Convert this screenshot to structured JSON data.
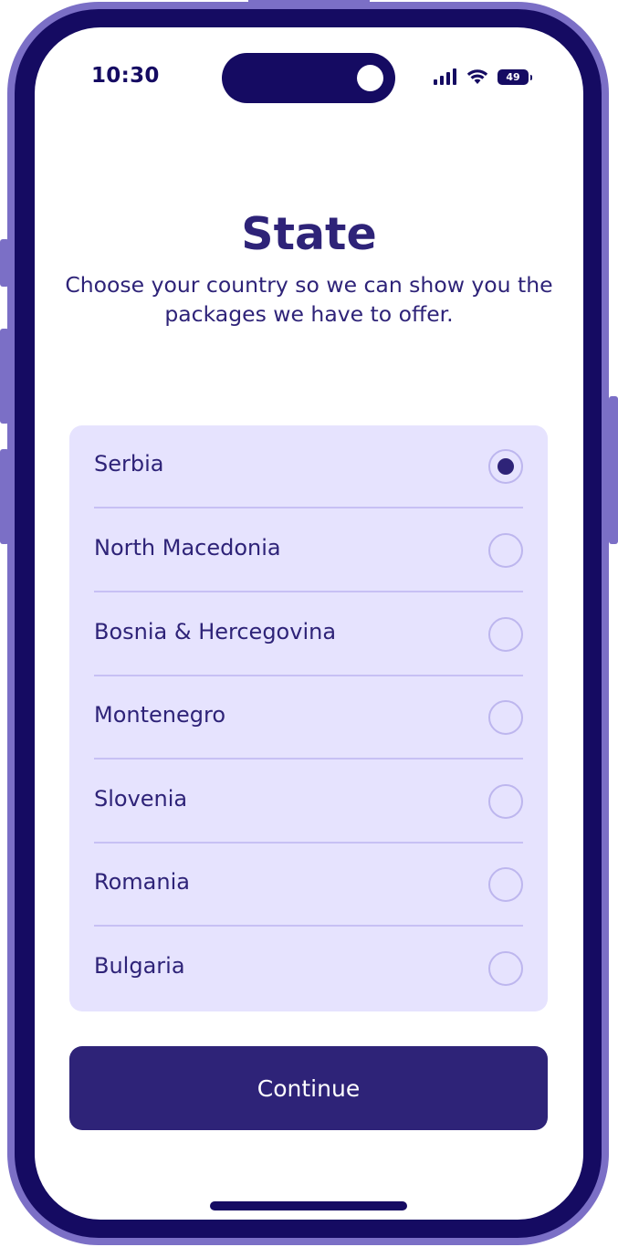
{
  "status_bar": {
    "time": "10:30",
    "battery_level": "49",
    "icons": [
      "cellular-signal-icon",
      "wifi-icon",
      "battery-icon"
    ]
  },
  "header": {
    "title": "State",
    "subtitle": "Choose your country so we can show you the packages we have to offer."
  },
  "countries": [
    {
      "label": "Serbia",
      "selected": true
    },
    {
      "label": "North Macedonia",
      "selected": false
    },
    {
      "label": "Bosnia & Hercegovina",
      "selected": false
    },
    {
      "label": "Montenegro",
      "selected": false
    },
    {
      "label": "Slovenia",
      "selected": false
    },
    {
      "label": "Romania",
      "selected": false
    },
    {
      "label": "Bulgaria",
      "selected": false
    }
  ],
  "actions": {
    "continue_label": "Continue"
  },
  "colors": {
    "primary": "#2e2378",
    "frame": "#7b6fc6",
    "bezel": "#150b62",
    "list_background": "#e6e3fe",
    "divider": "#c7c0f4"
  }
}
